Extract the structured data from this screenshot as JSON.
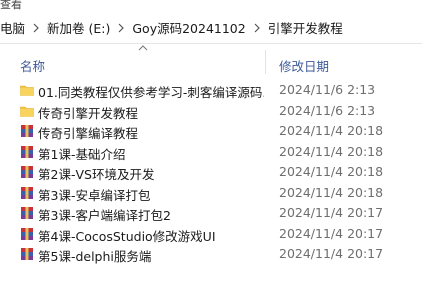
{
  "window": {
    "top_label": "查看"
  },
  "breadcrumb": [
    {
      "label": "电脑"
    },
    {
      "label": "新加卷 (E:)"
    },
    {
      "label": "Goy源码20241102"
    },
    {
      "label": "引擎开发教程"
    }
  ],
  "columns": {
    "name": "名称",
    "modified": "修改日期"
  },
  "files": [
    {
      "name": "01.同类教程仅供参考学习-刺客编译源码...",
      "modified": "2024/11/6 2:13",
      "type": "folder"
    },
    {
      "name": "传奇引擎开发教程",
      "modified": "2024/11/6 2:13",
      "type": "folder"
    },
    {
      "name": "传奇引擎编译教程",
      "modified": "2024/11/4 20:18",
      "type": "archive"
    },
    {
      "name": "第1课-基础介绍",
      "modified": "2024/11/4 20:18",
      "type": "archive"
    },
    {
      "name": "第2课-VS环境及开发",
      "modified": "2024/11/4 20:18",
      "type": "archive"
    },
    {
      "name": "第3课-安卓编译打包",
      "modified": "2024/11/4 20:18",
      "type": "archive"
    },
    {
      "name": "第3课-客户端编译打包2",
      "modified": "2024/11/4 20:17",
      "type": "archive"
    },
    {
      "name": "第4课-CocosStudio修改游戏UI",
      "modified": "2024/11/4 20:17",
      "type": "archive"
    },
    {
      "name": "第5课-delphi服务端",
      "modified": "2024/11/4 20:17",
      "type": "archive"
    }
  ],
  "colors": {
    "header_text": "#3d5a99",
    "folder": "#f4c542",
    "archive_red": "#c8323a",
    "archive_blue": "#3a5fb0"
  }
}
